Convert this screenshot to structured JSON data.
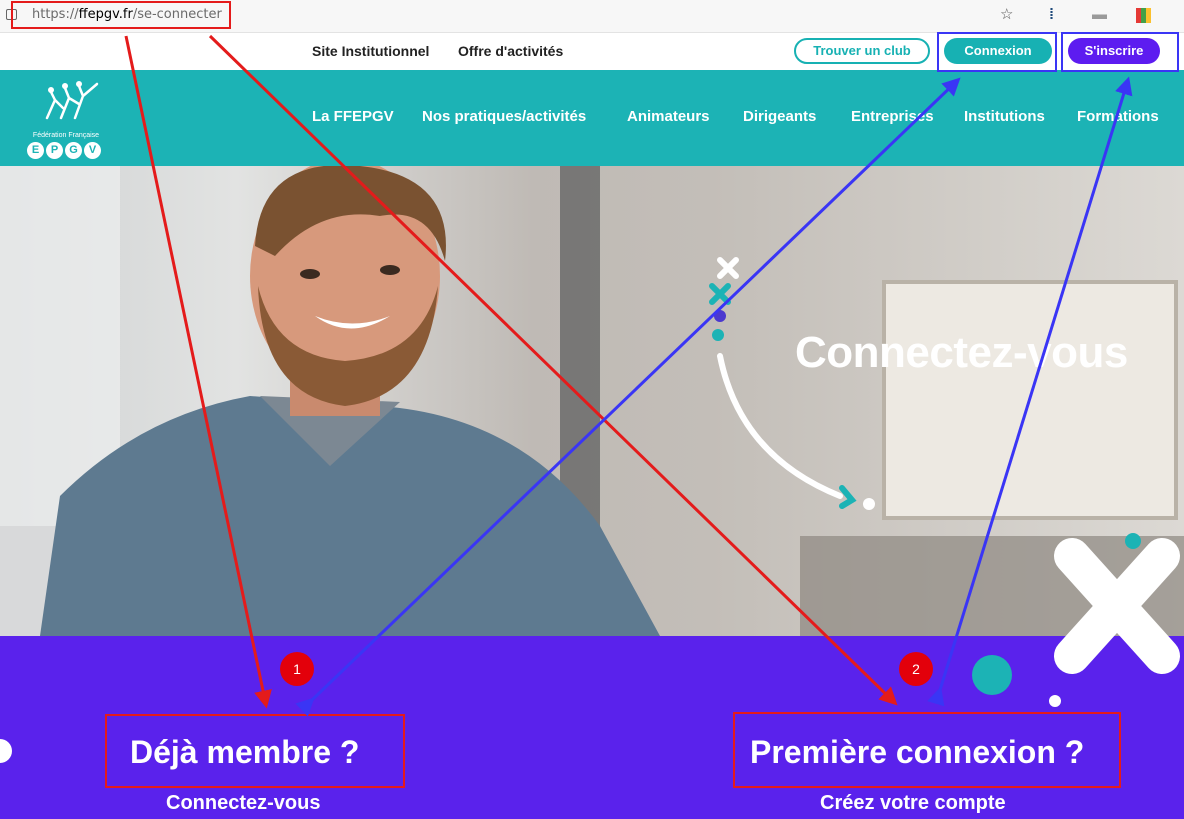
{
  "browser": {
    "url_prefix": "https://",
    "url_host": "ffepgv.fr",
    "url_path": "/se-connecter",
    "icons": [
      "lock-icon",
      "favorite-add-icon",
      "extension-icon",
      "folder-icon",
      "colorful-extension-icon"
    ]
  },
  "top_nav": {
    "links": [
      "Site Institutionnel",
      "Offre d'activités"
    ],
    "find_club": "Trouver un club",
    "login": "Connexion",
    "signup": "S'inscrire"
  },
  "logo": {
    "tagline": "Fédération Française",
    "letters": [
      "E",
      "P",
      "G",
      "V"
    ]
  },
  "main_nav": {
    "items": [
      "La FFEPGV",
      "Nos pratiques/activités",
      "Animateurs",
      "Dirigeants",
      "Entreprises",
      "Institutions",
      "Formations"
    ]
  },
  "hero": {
    "title": "Connectez-vous"
  },
  "band": {
    "left_badge": "1",
    "left_title": "Déjà membre ?",
    "left_sub": "Connectez-vous",
    "right_badge": "2",
    "right_title": "Première connexion ?",
    "right_sub": "Créez votre compte"
  },
  "colors": {
    "teal": "#1cb3b5",
    "purple": "#5a22ec",
    "annotation_red": "#e41b1b",
    "annotation_blue": "#3a35f5"
  }
}
